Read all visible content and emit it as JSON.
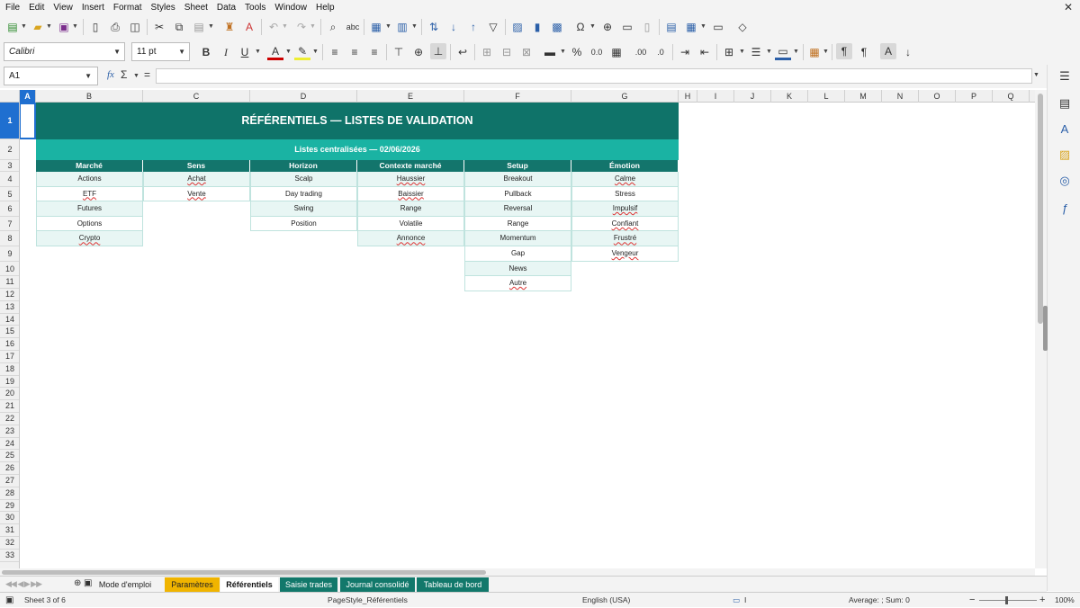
{
  "menu": [
    "File",
    "Edit",
    "View",
    "Insert",
    "Format",
    "Styles",
    "Sheet",
    "Data",
    "Tools",
    "Window",
    "Help"
  ],
  "toolbar": {
    "font_name": "Calibri",
    "font_size": "11 pt"
  },
  "formula_bar": {
    "cell_ref": "A1",
    "fx": "fx",
    "sum": "Σ",
    "equals": "="
  },
  "columns": [
    "A",
    "B",
    "C",
    "D",
    "E",
    "F",
    "G",
    "H",
    "I",
    "J",
    "K",
    "L",
    "M",
    "N",
    "O",
    "P",
    "Q"
  ],
  "rows": [
    "1",
    "2",
    "3",
    "4",
    "5",
    "6",
    "7",
    "8",
    "9",
    "10",
    "11",
    "12",
    "13",
    "14",
    "15",
    "16",
    "17",
    "18",
    "19",
    "20",
    "21",
    "22",
    "23",
    "24",
    "25",
    "26",
    "27",
    "28",
    "29",
    "30",
    "31",
    "32",
    "33"
  ],
  "sheet": {
    "title": "RÉFÉRENTIELS — LISTES DE VALIDATION",
    "subtitle": "Listes centralisées — 02/06/2026",
    "headers": [
      "Marché",
      "Sens",
      "Horizon",
      "Contexte marché",
      "Setup",
      "Émotion"
    ],
    "lists": [
      [
        "Actions",
        "ETF",
        "Futures",
        "Options",
        "Crypto"
      ],
      [
        "Achat",
        "Vente"
      ],
      [
        "Scalp",
        "Day trading",
        "Swing",
        "Position"
      ],
      [
        "Haussier",
        "Baissier",
        "Range",
        "Volatile",
        "Annonce"
      ],
      [
        "Breakout",
        "Pullback",
        "Reversal",
        "Range",
        "Momentum",
        "Gap",
        "News",
        "Autre"
      ],
      [
        "Calme",
        "Stress",
        "Impulsif",
        "Confiant",
        "Frustré",
        "Vengeur"
      ]
    ],
    "colors": {
      "title_bg": "#0f7369",
      "subtitle_bg": "#1ab3a3",
      "header_bg": "#13756c",
      "row_alt": "#e8f6f4"
    }
  },
  "tabs": [
    {
      "label": "Mode d'emploi",
      "bg": "#f3f3f3",
      "fg": "#222"
    },
    {
      "label": "Paramètres",
      "bg": "#f0b400",
      "fg": "#222"
    },
    {
      "label": "Référentiels",
      "bg": "#ffffff",
      "fg": "#111"
    },
    {
      "label": "Saisie trades",
      "bg": "#12786b",
      "fg": "#ffffff"
    },
    {
      "label": "Journal consolidé",
      "bg": "#12786b",
      "fg": "#ffffff"
    },
    {
      "label": "Tableau de bord",
      "bg": "#12786b",
      "fg": "#ffffff"
    }
  ],
  "status": {
    "sheet": "Sheet 3 of 6",
    "page_style": "PageStyle_Référentiels",
    "language": "English (USA)",
    "aggregate": "Average: ; Sum: 0",
    "zoom": "100%"
  }
}
